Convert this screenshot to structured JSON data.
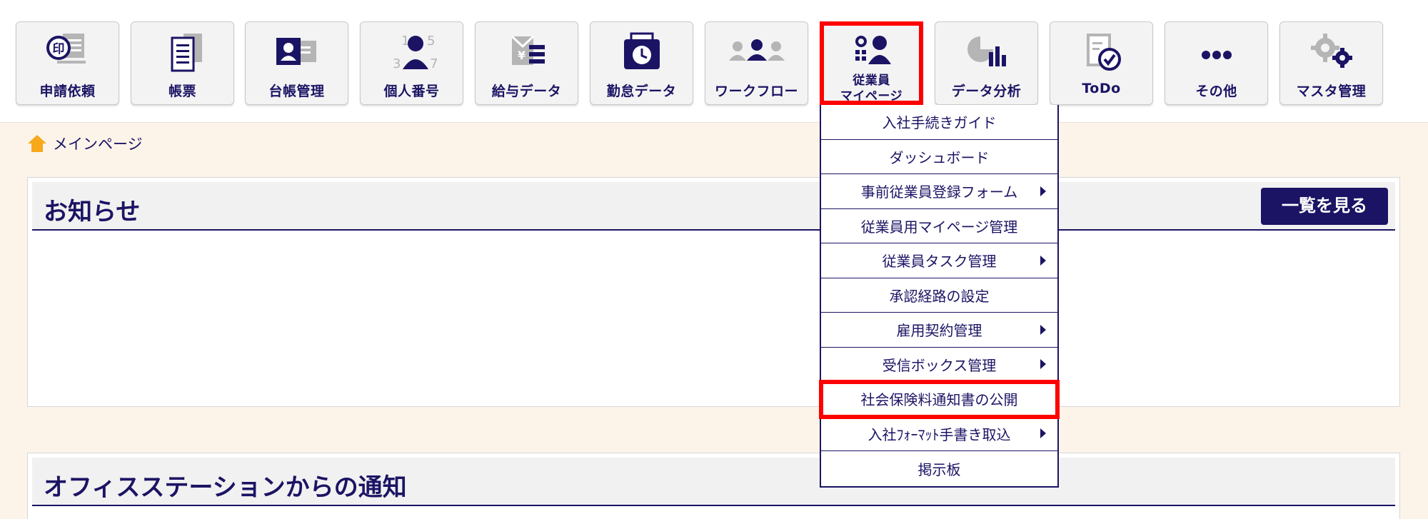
{
  "nav": {
    "tiles": [
      {
        "label": "申請依頼",
        "icon": "stamp-request-icon"
      },
      {
        "label": "帳票",
        "icon": "document-form-icon"
      },
      {
        "label": "台帳管理",
        "icon": "ledger-id-card-icon"
      },
      {
        "label": "個人番号",
        "icon": "personal-number-icon",
        "digits": [
          "1",
          "5",
          "3",
          "7"
        ]
      },
      {
        "label": "給与データ",
        "icon": "salary-envelope-icon"
      },
      {
        "label": "勤怠データ",
        "icon": "attendance-clock-icon"
      },
      {
        "label": "ワークフロー",
        "icon": "workflow-people-icon"
      },
      {
        "label_line1": "従業員",
        "label_line2": "マイページ",
        "icon": "employee-mypage-icon",
        "selected": true
      },
      {
        "label": "データ分析",
        "icon": "data-analysis-chart-icon"
      },
      {
        "label": "ToDo",
        "icon": "todo-check-icon"
      },
      {
        "label": "その他",
        "icon": "more-dots-icon"
      },
      {
        "label": "マスタ管理",
        "icon": "master-settings-gear-icon"
      }
    ]
  },
  "breadcrumb": {
    "label": "メインページ",
    "icon": "home-icon"
  },
  "notice_panel": {
    "title": "お知らせ",
    "button_label": "一覧を見る"
  },
  "office_panel": {
    "title": "オフィスステーションからの通知"
  },
  "dropdown": {
    "items": [
      {
        "label": "入社手続きガイド",
        "has_submenu": false
      },
      {
        "label": "ダッシュボード",
        "has_submenu": false
      },
      {
        "label": "事前従業員登録フォーム",
        "has_submenu": true
      },
      {
        "label": "従業員用マイページ管理",
        "has_submenu": false
      },
      {
        "label": "従業員タスク管理",
        "has_submenu": true
      },
      {
        "label": "承認経路の設定",
        "has_submenu": false
      },
      {
        "label": "雇用契約管理",
        "has_submenu": true
      },
      {
        "label": "受信ボックス管理",
        "has_submenu": true
      },
      {
        "label": "社会保険料通知書の公開",
        "has_submenu": false,
        "highlighted": true
      },
      {
        "label": "入社ﾌｫｰﾏｯﾄ手書き取込",
        "has_submenu": true
      },
      {
        "label": "掲示板",
        "has_submenu": false
      }
    ]
  },
  "colors": {
    "brand_navy": "#1b1464",
    "highlight_red": "#ff0000",
    "background": "#fdf4e9",
    "tile_bg": "#f3f3f3",
    "icon_gray": "#b5b5b5"
  }
}
